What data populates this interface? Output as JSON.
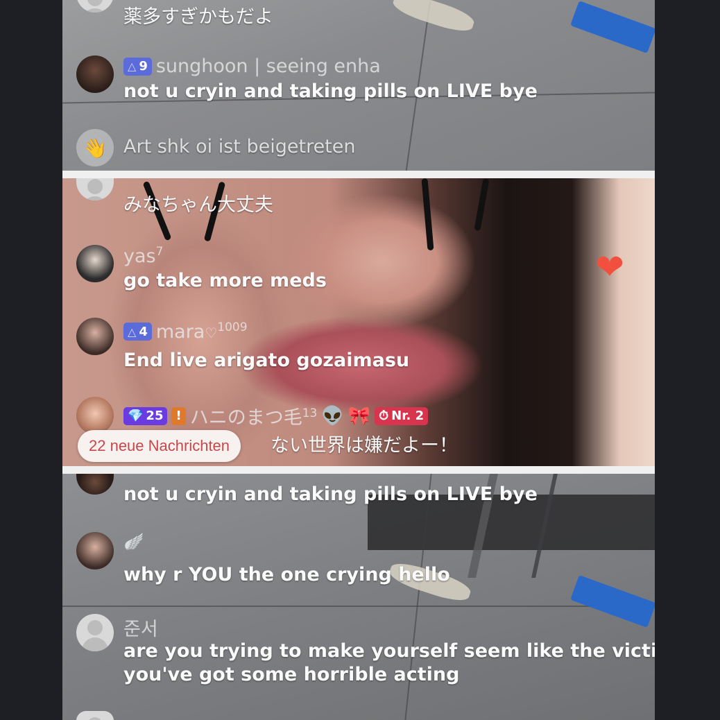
{
  "chat_top": {
    "partial_message": "薬多すぎかもだよ",
    "message_1": {
      "level": "9",
      "username": "sunghoon | seeing enha",
      "text": "not u cryin and taking pills on LIVE bye"
    },
    "join_notice": "Art   shk    oi ist beigetreten"
  },
  "chat_mid": {
    "partial_message": "みなちゃん大丈夫",
    "message_1": {
      "username": "yas",
      "username_sup": "7",
      "text": "go take more meds"
    },
    "message_2": {
      "level": "4",
      "username": "mara",
      "username_sup": "1009",
      "text": "End live arigato gozaimasu"
    },
    "message_3": {
      "gem_level": "25",
      "heart_badge": "!",
      "username": "ハニのまつ毛",
      "username_sup": "13",
      "emoji_1": "👽",
      "emoji_2": "🎀",
      "rank_badge": "Nr. 2",
      "text": "ない世界は嫌だよー！"
    },
    "new_messages_pill": "22 neue Nachrichten"
  },
  "chat_bottom": {
    "partial_message": "not u cryin and taking pills on LIVE bye",
    "message_1": {
      "username_icon": "🪽",
      "text": "why r YOU the one crying hello"
    },
    "message_2": {
      "username": "준서",
      "text_line_1": "are you trying to make yourself seem like the victim?",
      "text_line_2": "you've got some horrible acting"
    }
  },
  "colors": {
    "page_background": "#1d1f24",
    "divider": "#f0f0f0",
    "heart": "#f2503f",
    "pill_text": "#c7484a"
  }
}
